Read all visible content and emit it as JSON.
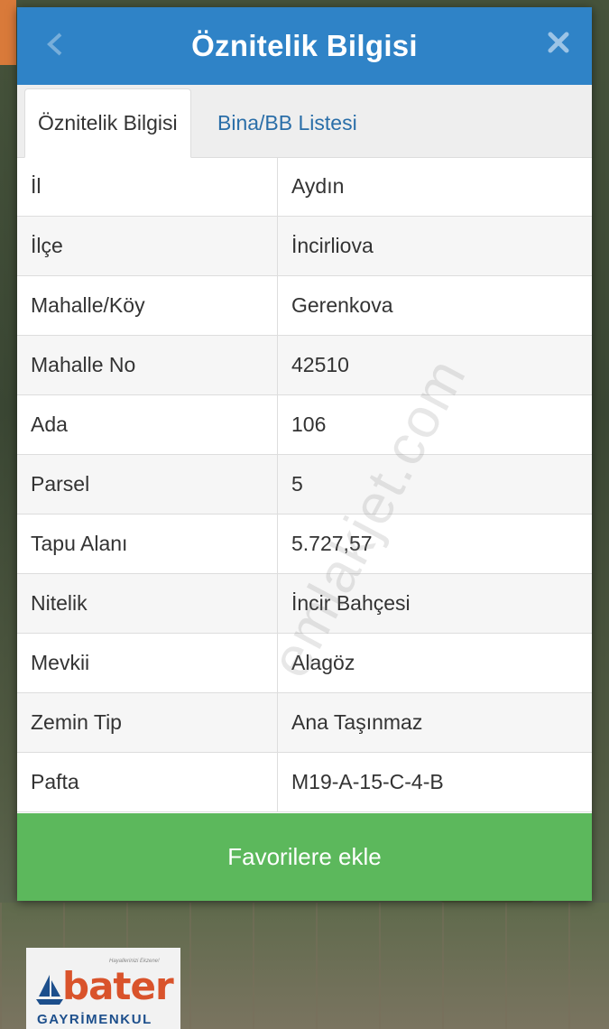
{
  "dialog": {
    "title": "Öznitelik Bilgisi",
    "close_icon": "close-icon",
    "header_color": "#2f83c7"
  },
  "tabs": [
    {
      "label": "Öznitelik Bilgisi",
      "active": true
    },
    {
      "label": "Bina/BB Listesi",
      "active": false
    }
  ],
  "attributes": [
    {
      "key": "İl",
      "value": "Aydın"
    },
    {
      "key": "İlçe",
      "value": "İncirliova"
    },
    {
      "key": "Mahalle/Köy",
      "value": "Gerenkova"
    },
    {
      "key": "Mahalle No",
      "value": "42510"
    },
    {
      "key": "Ada",
      "value": "106"
    },
    {
      "key": "Parsel",
      "value": "5"
    },
    {
      "key": "Tapu Alanı",
      "value": "5.727,57"
    },
    {
      "key": "Nitelik",
      "value": "İncir Bahçesi"
    },
    {
      "key": "Mevkii",
      "value": "Alagöz"
    },
    {
      "key": "Zemin Tip",
      "value": "Ana Taşınmaz"
    },
    {
      "key": "Pafta",
      "value": "M19-A-15-C-4-B"
    }
  ],
  "favorite_button": {
    "label": "Favorilere ekle",
    "color": "#5cb85c"
  },
  "watermark": "emlakjet.com",
  "logo": {
    "name": "bater",
    "subtitle": "GAYRİMENKUL",
    "tagline": "Hayallerinizi Ekzene!"
  }
}
